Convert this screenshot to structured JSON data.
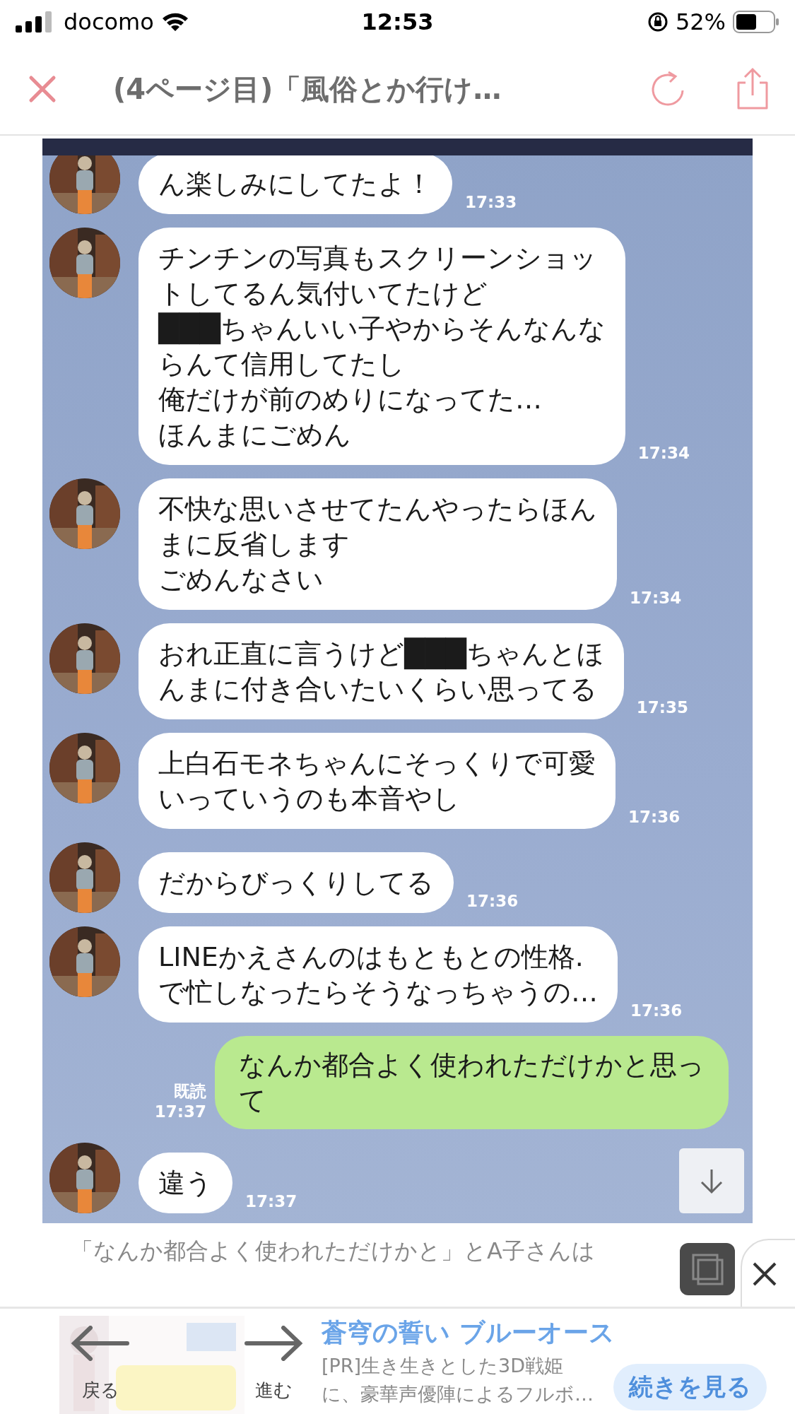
{
  "status_bar": {
    "carrier": "docomo",
    "time": "12:53",
    "battery": "52%"
  },
  "nav": {
    "title": "(4ページ目)「風俗とか行け…"
  },
  "chat": {
    "messages": [
      {
        "kind": "received",
        "lines": [
          "ん楽しみにしてたよ！"
        ],
        "time": "17:33"
      },
      {
        "kind": "received",
        "lines": [
          "チンチンの写真もスクリーンショッ",
          "トしてるん気付いてたけど",
          "███ちゃんいい子やからそんなんな",
          "らんて信用してたし",
          "俺だけが前のめりになってた…",
          "ほんまにごめん"
        ],
        "time": "17:34"
      },
      {
        "kind": "received",
        "lines": [
          "不快な思いさせてたんやったらほん",
          "まに反省します",
          "ごめんなさい"
        ],
        "time": "17:34"
      },
      {
        "kind": "received",
        "lines": [
          "おれ正直に言うけど███ちゃんとほ",
          "んまに付き合いたいくらい思ってる"
        ],
        "time": "17:35"
      },
      {
        "kind": "received",
        "lines": [
          "上白石モネちゃんにそっくりで可愛",
          "いっていうのも本音やし"
        ],
        "time": "17:36"
      },
      {
        "kind": "received",
        "lines": [
          "だからびっくりしてる"
        ],
        "time": "17:36"
      },
      {
        "kind": "received",
        "lines": [
          "LINEかえさんのはもともとの性格.",
          "で忙しなったらそうなっちゃうの…"
        ],
        "time": "17:36"
      },
      {
        "kind": "sent",
        "lines": [
          "なんか都合よく使われただけかと思っ",
          "て"
        ],
        "time": "17:37",
        "read": "既読"
      },
      {
        "kind": "received",
        "lines": [
          "違う"
        ],
        "time": "17:37"
      }
    ]
  },
  "caption": {
    "text": "「なんか都合よく使われただけかと」とA子さんは"
  },
  "ad": {
    "title": "蒼穹の誓い ブルーオース",
    "lines": [
      "[PR]生き生きとした3D戦姫",
      "に、豪華声優陣によるフルボ…"
    ],
    "button": "続きを見る"
  },
  "toolbar": {
    "back": "戻る",
    "forward": "進む"
  }
}
